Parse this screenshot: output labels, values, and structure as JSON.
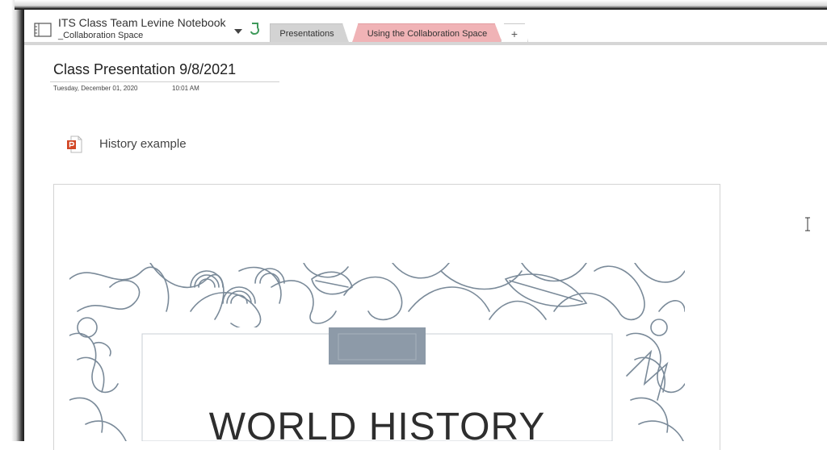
{
  "notebook": {
    "title": "ITS Class Team Levine Notebook",
    "section": "_Collaboration Space"
  },
  "tabs": [
    {
      "label": "Presentations",
      "color": "#d3d3d3",
      "selected": true
    },
    {
      "label": "Using the Collaboration Space",
      "color": "#f0b3b6",
      "selected": false
    }
  ],
  "add_tab_label": "+",
  "page": {
    "title": "Class Presentation 9/8/2021",
    "date": "Tuesday, December 01, 2020",
    "time": "10:01 AM"
  },
  "attachment": {
    "label": "History example",
    "icon": "powerpoint-file-icon"
  },
  "slide": {
    "title": "WORLD HISTORY",
    "art_color": "#7a8a99",
    "badge_color": "#8d9aa8"
  }
}
